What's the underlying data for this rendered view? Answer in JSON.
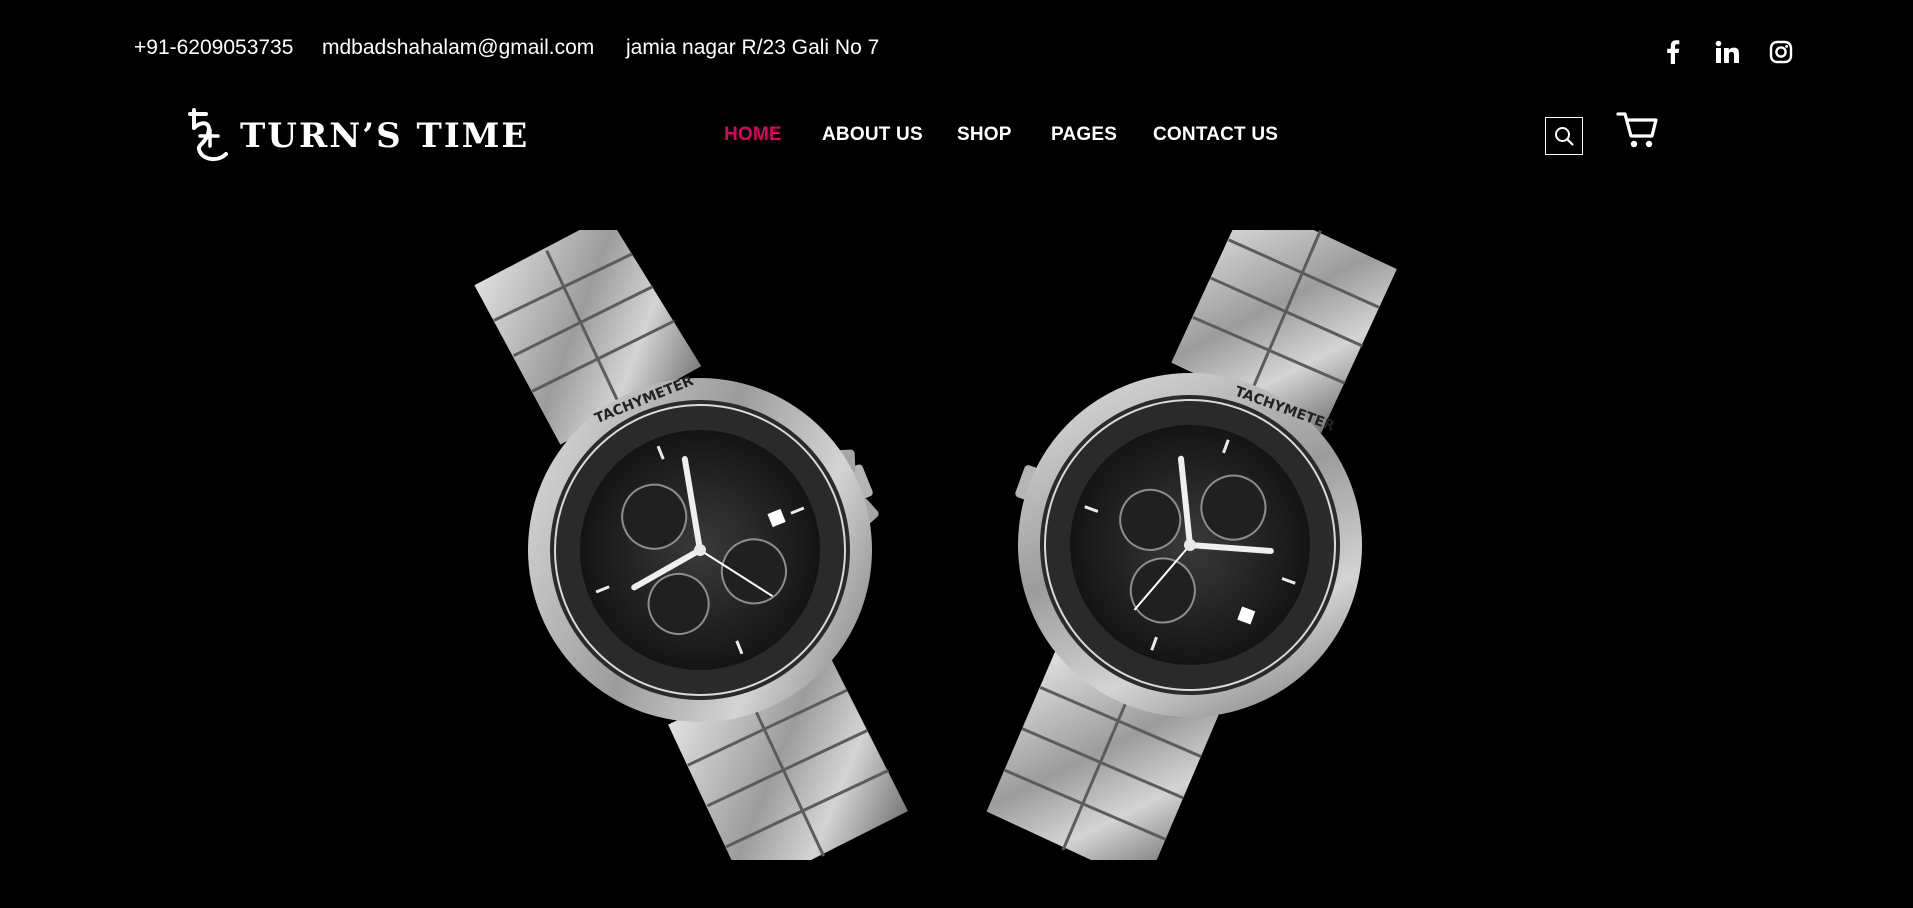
{
  "topbar": {
    "phone": "+91-6209053735",
    "email": "mdbadshahalam@gmail.com",
    "address": "jamia nagar R/23 Gali No 7",
    "social": [
      "facebook-icon",
      "linkedin-icon",
      "instagram-icon"
    ]
  },
  "brand": {
    "name": "TURN’S TIME"
  },
  "nav": {
    "active_color": "#e0005f",
    "items": [
      {
        "label": "HOME",
        "active": true
      },
      {
        "label": "ABOUT US",
        "active": false
      },
      {
        "label": "SHOP",
        "active": false
      },
      {
        "label": "PAGES",
        "active": false
      },
      {
        "label": "CONTACT US",
        "active": false
      }
    ]
  },
  "icons": {
    "search": "search-icon",
    "cart": "cart-icon"
  },
  "hero": {
    "image": "two-silver-chronograph-watches",
    "left_watch": {
      "bezel_label": "TACHYMETER"
    },
    "right_watch": {
      "bezel_label": "TACHYMETER"
    }
  }
}
